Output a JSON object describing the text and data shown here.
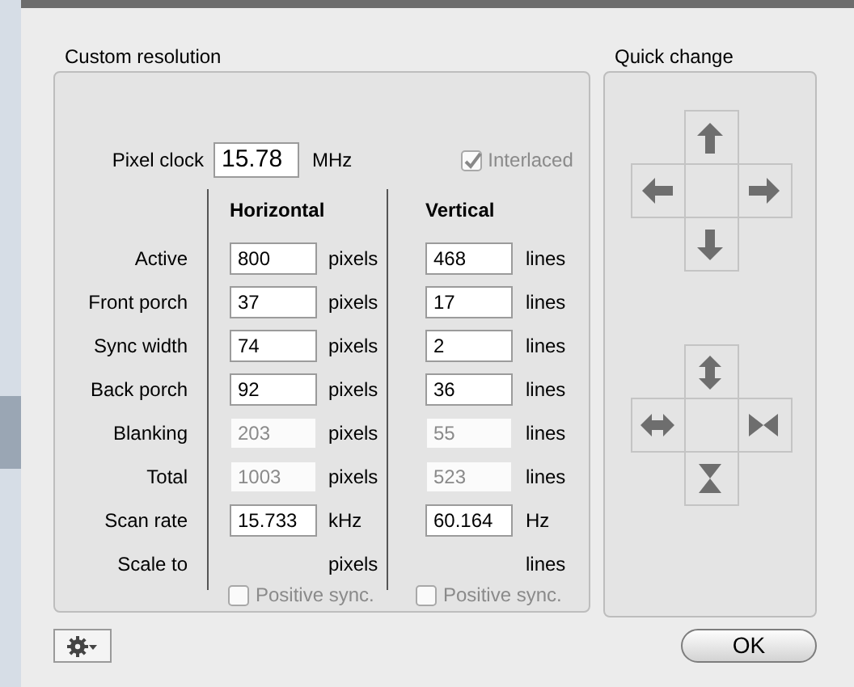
{
  "custom_resolution": {
    "title": "Custom resolution",
    "pixel_clock": {
      "label": "Pixel clock",
      "value": "15.78",
      "unit": "MHz"
    },
    "interlaced": {
      "label": "Interlaced",
      "checked": true,
      "disabled": true
    },
    "columns": [
      "Horizontal",
      "Vertical"
    ],
    "rows": [
      {
        "label": "Active",
        "kind": "input",
        "horizontal": "800",
        "h_unit": "pixels",
        "vertical": "468",
        "v_unit": "lines"
      },
      {
        "label": "Front porch",
        "kind": "input",
        "horizontal": "37",
        "h_unit": "pixels",
        "vertical": "17",
        "v_unit": "lines"
      },
      {
        "label": "Sync width",
        "kind": "input",
        "horizontal": "74",
        "h_unit": "pixels",
        "vertical": "2",
        "v_unit": "lines"
      },
      {
        "label": "Back porch",
        "kind": "input",
        "horizontal": "92",
        "h_unit": "pixels",
        "vertical": "36",
        "v_unit": "lines"
      },
      {
        "label": "Blanking",
        "kind": "computed",
        "horizontal": "203",
        "h_unit": "pixels",
        "vertical": "55",
        "v_unit": "lines"
      },
      {
        "label": "Total",
        "kind": "computed",
        "horizontal": "1003",
        "h_unit": "pixels",
        "vertical": "523",
        "v_unit": "lines"
      },
      {
        "label": "Scan rate",
        "kind": "input",
        "horizontal": "15.733",
        "h_unit": "kHz",
        "vertical": "60.164",
        "v_unit": "Hz"
      },
      {
        "label": "Scale to",
        "kind": "empty",
        "h_unit": "pixels",
        "v_unit": "lines"
      }
    ],
    "sync": [
      {
        "label": "Positive sync.",
        "checked": false,
        "disabled": true
      },
      {
        "label": "Positive sync.",
        "checked": false,
        "disabled": true
      }
    ]
  },
  "quick_change": {
    "title": "Quick change"
  },
  "ok_button": "OK"
}
